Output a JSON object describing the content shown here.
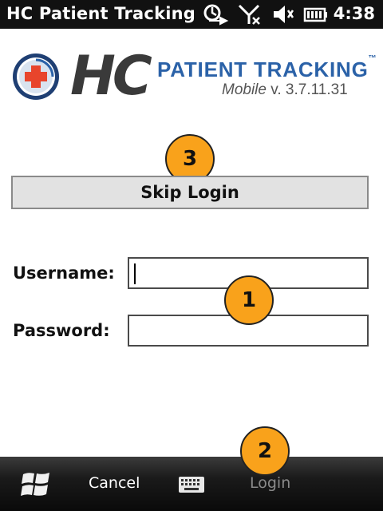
{
  "status_bar": {
    "title": "HC Patient Tracking",
    "time": "4:38",
    "icons": [
      "sync-icon",
      "no-signal-icon",
      "volume-muted-icon",
      "battery-icon"
    ]
  },
  "header": {
    "logo_hc": "HC",
    "brand": "PATIENT TRACKING",
    "trademark": "™",
    "version_mobile": "Mobile",
    "version_text": " v. 3.7.11.31"
  },
  "callouts": {
    "one": "1",
    "two": "2",
    "three": "3"
  },
  "skip_login_label": "Skip Login",
  "form": {
    "username_label": "Username:",
    "username_value": "",
    "password_label": "Password:",
    "password_value": ""
  },
  "bottom_bar": {
    "cancel_label": "Cancel",
    "login_label": "Login",
    "login_enabled": false
  },
  "colors": {
    "callout": "#f9a21b",
    "brand_blue": "#2b62a8",
    "status_bar": "#111111"
  }
}
